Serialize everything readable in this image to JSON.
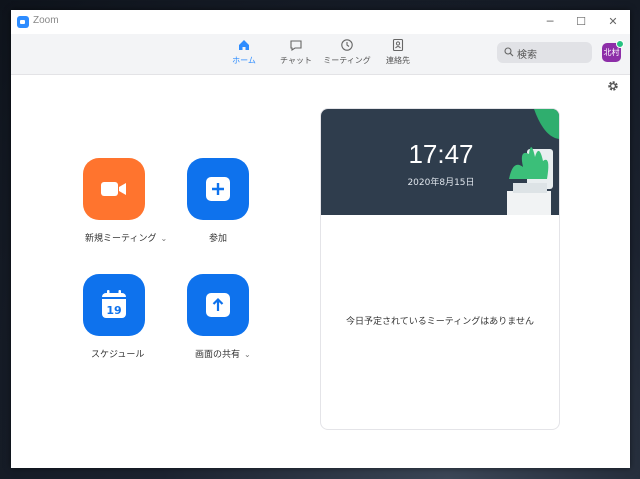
{
  "app": {
    "title": "Zoom"
  },
  "window_controls": {
    "minimize": "─",
    "maximize": "☐",
    "close": "✕"
  },
  "nav": {
    "tabs": [
      {
        "label": "ホーム",
        "icon": "home-icon",
        "active": true
      },
      {
        "label": "チャット",
        "icon": "chat-icon",
        "active": false
      },
      {
        "label": "ミーティング",
        "icon": "clock-icon",
        "active": false
      },
      {
        "label": "連絡先",
        "icon": "contacts-icon",
        "active": false
      }
    ]
  },
  "search": {
    "placeholder": "検索",
    "icon": "search-icon"
  },
  "avatar": {
    "initials": "北村",
    "color": "#8d2ea8",
    "status": "online"
  },
  "actions": [
    {
      "label": "新規ミーティング",
      "icon": "video-camera-icon",
      "color": "#ff742e",
      "has_dropdown": true
    },
    {
      "label": "参加",
      "icon": "plus-icon",
      "color": "#0e72ed",
      "has_dropdown": false
    },
    {
      "label": "スケジュール",
      "icon": "calendar-icon",
      "calendar_day": "19",
      "color": "#0e72ed",
      "has_dropdown": false
    },
    {
      "label": "画面の共有",
      "icon": "share-screen-arrow-icon",
      "color": "#0e72ed",
      "has_dropdown": true
    }
  ],
  "schedule_card": {
    "time": "17:47",
    "date": "2020年8月15日",
    "empty_message": "今日予定されているミーティングはありません"
  },
  "colors": {
    "accent": "#2d8cff",
    "orange": "#ff742e",
    "blue": "#0e72ed",
    "card_header": "#2f3d4d"
  }
}
